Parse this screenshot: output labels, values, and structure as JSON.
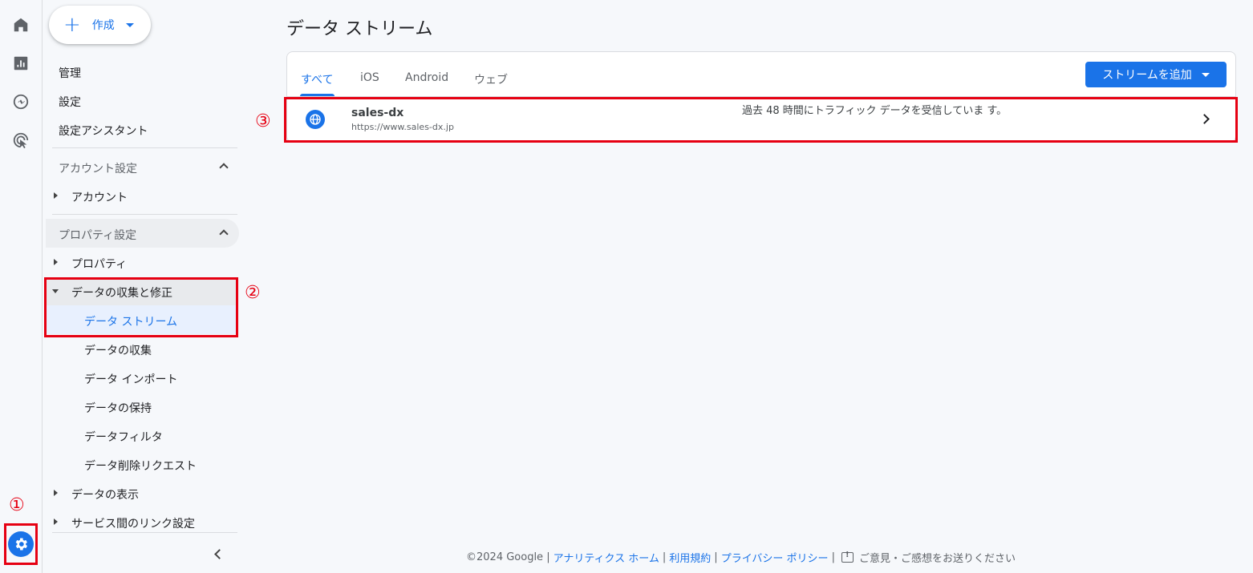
{
  "annotations": {
    "one": "①",
    "two": "②",
    "three": "③"
  },
  "create": {
    "label": "作成"
  },
  "nav": {
    "manage": "管理",
    "settings": "設定",
    "setup_assistant": "設定アシスタント",
    "account_settings_head": "アカウント設定",
    "account": "アカウント",
    "property_settings_head": "プロパティ設定",
    "property": "プロパティ",
    "data_collection_modify": "データの収集と修正",
    "data_streams": "データ ストリーム",
    "data_collection": "データの収集",
    "data_import": "データ インポート",
    "data_retention": "データの保持",
    "data_filters": "データフィルタ",
    "data_deletion": "データ削除リクエスト",
    "data_display": "データの表示",
    "product_links": "サービス間のリンク設定"
  },
  "main": {
    "title": "データ ストリーム",
    "tabs": [
      "すべて",
      "iOS",
      "Android",
      "ウェブ"
    ],
    "add_stream_label": "ストリームを追加",
    "stream": {
      "name": "sales-dx",
      "url": "https://www.sales-dx.jp",
      "status": "過去 48 時間にトラフィック データを受信していま す。"
    }
  },
  "footer": {
    "copyright": "©2024 Google |",
    "analytics_home": "アナリティクス ホーム",
    "sep1": "|",
    "terms": "利用規約",
    "sep2": "|",
    "privacy": "プライバシー ポリシー",
    "sep3": "|",
    "feedback": "ご意見・ご感想をお送りください"
  },
  "colors": {
    "accent": "#1a73e8",
    "annotation_red": "#e60012"
  }
}
